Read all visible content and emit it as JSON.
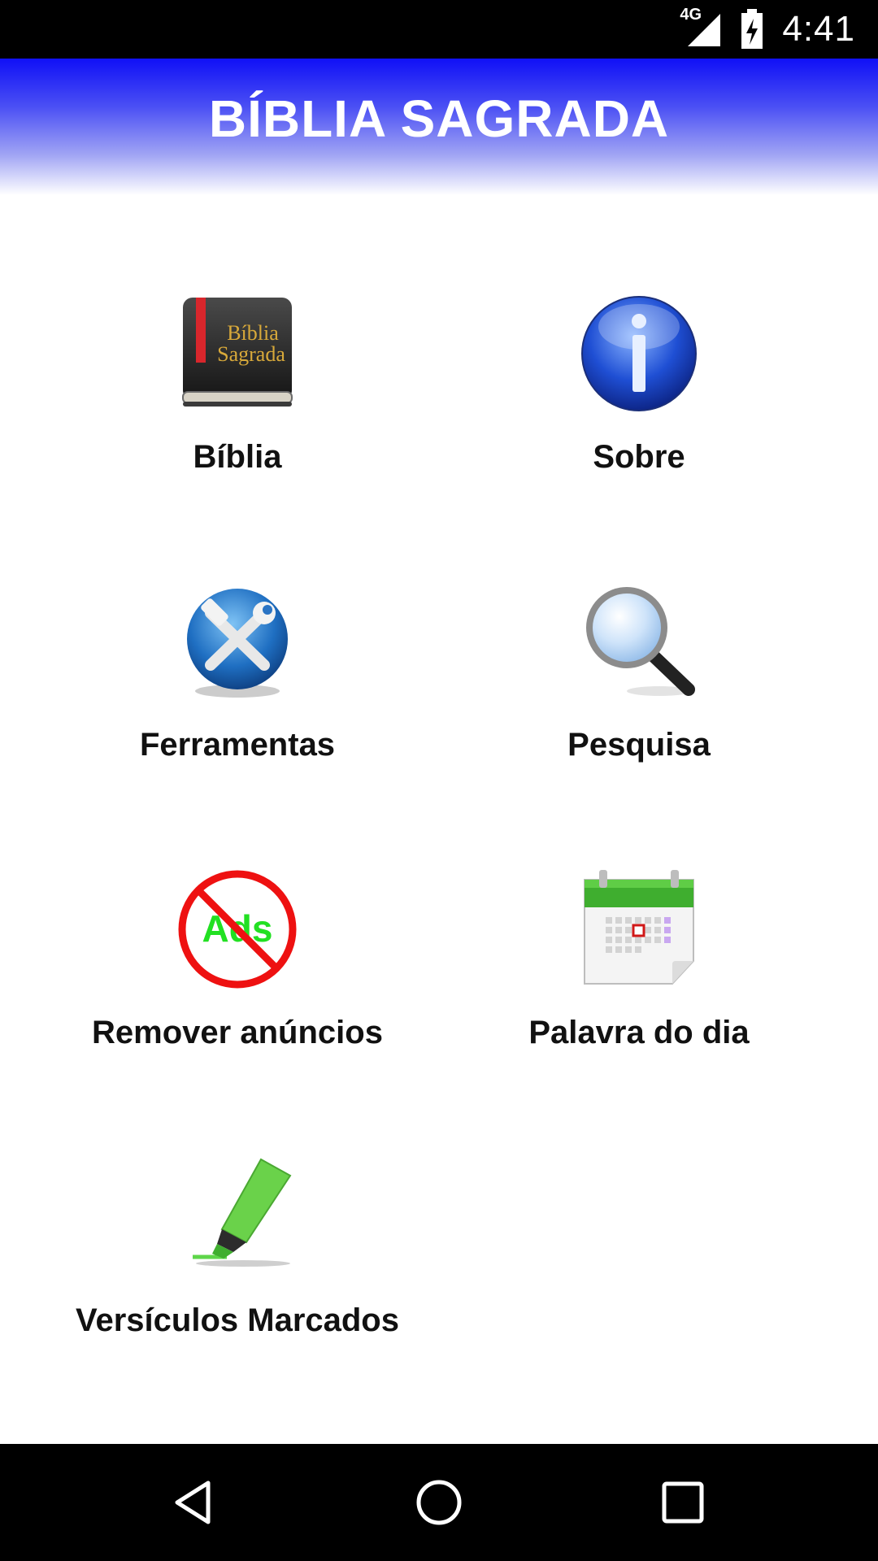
{
  "status_bar": {
    "network": "4G",
    "time": "4:41",
    "icons": [
      "signal-icon",
      "battery-charging-icon"
    ]
  },
  "header": {
    "title": "BÍBLIA SAGRADA",
    "gradient_colors": [
      "#1010f6",
      "#ffffff"
    ]
  },
  "book_icon_text": [
    "Bíblia",
    "Sagrada"
  ],
  "ads_icon_text": "Ads",
  "menu": [
    {
      "label": "Bíblia",
      "icon": "bible-book-icon"
    },
    {
      "label": "Sobre",
      "icon": "info-icon"
    },
    {
      "label": "Ferramentas",
      "icon": "tools-icon"
    },
    {
      "label": "Pesquisa",
      "icon": "magnifier-icon"
    },
    {
      "label": "Remover anúncios",
      "icon": "no-ads-icon"
    },
    {
      "label": "Palavra do dia",
      "icon": "calendar-icon"
    },
    {
      "label": "Versículos Marcados",
      "icon": "highlighter-icon"
    }
  ],
  "nav_bar": {
    "buttons": [
      "back-icon",
      "home-icon",
      "recents-icon"
    ]
  }
}
